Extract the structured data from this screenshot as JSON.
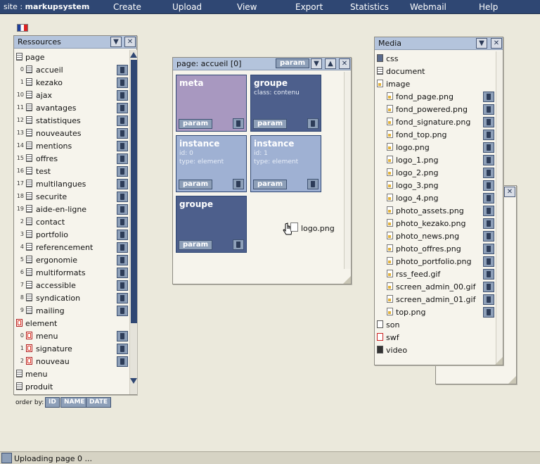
{
  "topbar": {
    "site_prefix": "site : ",
    "site_name": "markupsystem",
    "menu": [
      "Create",
      "Upload",
      "View",
      "Export",
      "Statistics",
      "Webmail",
      "Help"
    ]
  },
  "ressources": {
    "title": "Ressources",
    "rows": [
      {
        "num": "",
        "icon": "doc",
        "label": "page"
      },
      {
        "num": "0",
        "icon": "doc",
        "label": "accueil"
      },
      {
        "num": "1",
        "icon": "doc",
        "label": "kezako"
      },
      {
        "num": "10",
        "icon": "doc",
        "label": "ajax"
      },
      {
        "num": "11",
        "icon": "doc",
        "label": "avantages"
      },
      {
        "num": "12",
        "icon": "doc",
        "label": "statistiques"
      },
      {
        "num": "13",
        "icon": "doc",
        "label": "nouveautes"
      },
      {
        "num": "14",
        "icon": "doc",
        "label": "mentions"
      },
      {
        "num": "15",
        "icon": "doc",
        "label": "offres"
      },
      {
        "num": "16",
        "icon": "doc",
        "label": "test"
      },
      {
        "num": "17",
        "icon": "doc",
        "label": "multilangues"
      },
      {
        "num": "18",
        "icon": "doc",
        "label": "securite"
      },
      {
        "num": "19",
        "icon": "doc",
        "label": "aide-en-ligne"
      },
      {
        "num": "2",
        "icon": "doc",
        "label": "contact"
      },
      {
        "num": "3",
        "icon": "doc",
        "label": "portfolio"
      },
      {
        "num": "4",
        "icon": "doc",
        "label": "referencement"
      },
      {
        "num": "5",
        "icon": "doc",
        "label": "ergonomie"
      },
      {
        "num": "6",
        "icon": "doc",
        "label": "multiformats"
      },
      {
        "num": "7",
        "icon": "doc",
        "label": "accessible"
      },
      {
        "num": "8",
        "icon": "doc",
        "label": "syndication"
      },
      {
        "num": "9",
        "icon": "doc",
        "label": "mailing"
      },
      {
        "num": "",
        "icon": "elem",
        "label": "element"
      },
      {
        "num": "0",
        "icon": "elem",
        "label": "menu"
      },
      {
        "num": "1",
        "icon": "elem",
        "label": "signature"
      },
      {
        "num": "2",
        "icon": "elem",
        "label": "nouveau"
      },
      {
        "num": "",
        "icon": "doc",
        "label": "menu"
      },
      {
        "num": "",
        "icon": "doc",
        "label": "produit"
      }
    ],
    "order_by_label": "order by:",
    "order_buttons": [
      "ID",
      "NAME",
      "DATE"
    ]
  },
  "page_panel": {
    "title": "page: accueil [0]",
    "param_label": "param",
    "cards": [
      {
        "title": "meta",
        "line1": "",
        "line2": "",
        "color": "#a898c0",
        "param": "param"
      },
      {
        "title": "groupe",
        "line1": "class: contenu",
        "line2": "",
        "color": "#4d5f8c",
        "param": "param"
      },
      {
        "title": "instance",
        "line1": "id: 0",
        "line2": "type: element",
        "color": "#9fb1d3",
        "param": "param"
      },
      {
        "title": "instance",
        "line1": "id: 1",
        "line2": "type: element",
        "color": "#9fb1d3",
        "param": "param"
      },
      {
        "title": "groupe",
        "line1": "",
        "line2": "",
        "color": "#4d5f8c",
        "param": "param"
      }
    ],
    "drag_label": "logo.png"
  },
  "media": {
    "title": "Media",
    "rows": [
      {
        "icon": "css",
        "label": "css",
        "indent": 0,
        "trash": false
      },
      {
        "icon": "doc",
        "label": "document",
        "indent": 0,
        "trash": false
      },
      {
        "icon": "img",
        "label": "image",
        "indent": 0,
        "trash": false
      },
      {
        "icon": "img",
        "label": "fond_page.png",
        "indent": 1,
        "trash": true
      },
      {
        "icon": "img",
        "label": "fond_powered.png",
        "indent": 1,
        "trash": true
      },
      {
        "icon": "img",
        "label": "fond_signature.png",
        "indent": 1,
        "trash": true
      },
      {
        "icon": "img",
        "label": "fond_top.png",
        "indent": 1,
        "trash": true
      },
      {
        "icon": "img",
        "label": "logo.png",
        "indent": 1,
        "trash": true
      },
      {
        "icon": "img",
        "label": "logo_1.png",
        "indent": 1,
        "trash": true
      },
      {
        "icon": "img",
        "label": "logo_2.png",
        "indent": 1,
        "trash": true
      },
      {
        "icon": "img",
        "label": "logo_3.png",
        "indent": 1,
        "trash": true
      },
      {
        "icon": "img",
        "label": "logo_4.png",
        "indent": 1,
        "trash": true
      },
      {
        "icon": "img",
        "label": "photo_assets.png",
        "indent": 1,
        "trash": true
      },
      {
        "icon": "img",
        "label": "photo_kezako.png",
        "indent": 1,
        "trash": true
      },
      {
        "icon": "img",
        "label": "photo_news.png",
        "indent": 1,
        "trash": true
      },
      {
        "icon": "img",
        "label": "photo_offres.png",
        "indent": 1,
        "trash": true
      },
      {
        "icon": "img",
        "label": "photo_portfolio.png",
        "indent": 1,
        "trash": true
      },
      {
        "icon": "img",
        "label": "rss_feed.gif",
        "indent": 1,
        "trash": true
      },
      {
        "icon": "img",
        "label": "screen_admin_00.gif",
        "indent": 1,
        "trash": true
      },
      {
        "icon": "img",
        "label": "screen_admin_01.gif",
        "indent": 1,
        "trash": true
      },
      {
        "icon": "img",
        "label": "top.png",
        "indent": 1,
        "trash": true
      },
      {
        "icon": "son",
        "label": "son",
        "indent": 0,
        "trash": false
      },
      {
        "icon": "swf",
        "label": "swf",
        "indent": 0,
        "trash": false
      },
      {
        "icon": "video",
        "label": "video",
        "indent": 0,
        "trash": false
      }
    ]
  },
  "status": {
    "text": "Uploading page 0 ..."
  }
}
